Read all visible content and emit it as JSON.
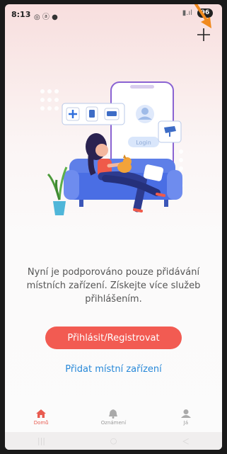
{
  "status_bar": {
    "time": "8:13",
    "battery": "96"
  },
  "main": {
    "message": "Nyní je podporováno pouze přidávání místních zařízení. Získejte více služeb přihlášením.",
    "login_button": "Přihlásit/Registrovat",
    "add_local_link": "Přidat místní zařízení",
    "illustration_login_label": "Login"
  },
  "tabs": [
    {
      "label": "Domů",
      "icon": "home-icon",
      "active": true
    },
    {
      "label": "Oznámení",
      "icon": "bell-icon",
      "active": false
    },
    {
      "label": "Já",
      "icon": "person-icon",
      "active": false
    }
  ],
  "colors": {
    "accent": "#f25b52",
    "link": "#2788d8",
    "annotation_arrow": "#f08a1e"
  }
}
